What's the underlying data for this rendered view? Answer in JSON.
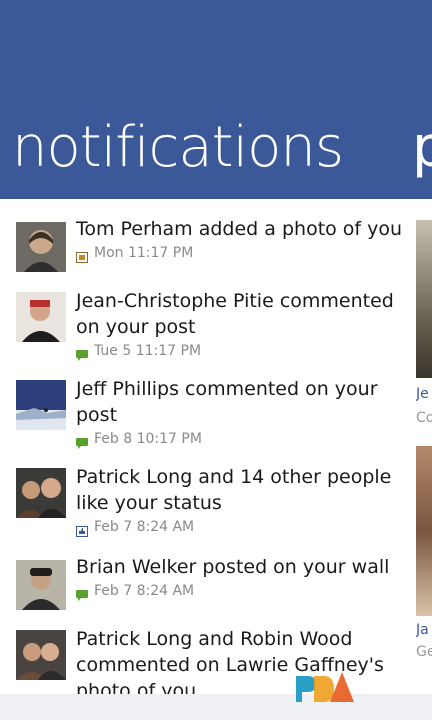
{
  "header": {
    "title": "notifications",
    "next_pivot_peek": "p",
    "color": "#3b5998"
  },
  "notifications": [
    {
      "message": "Tom Perham added a photo of you",
      "time": "Mon 11:17 PM",
      "icon": "photo-icon"
    },
    {
      "message": "Jean-Christophe Pitie commented on your post",
      "time": "Tue 5 11:17 PM",
      "icon": "comment-icon"
    },
    {
      "message": "Jeff Phillips commented on your post",
      "time": "Feb 8 10:17 PM",
      "icon": "comment-icon"
    },
    {
      "message": "Patrick Long and 14 other people like your status",
      "time": "Feb 7 8:24 AM",
      "icon": "like-icon"
    },
    {
      "message": "Brian Welker posted on your wall",
      "time": "Feb 7 8:24 AM",
      "icon": "comment-icon"
    },
    {
      "message": "Patrick Long and Robin Wood commented on Lawrie Gaffney's photo of you",
      "time": "",
      "icon": "comment-icon"
    }
  ],
  "side_panel": {
    "item1_title": "Je",
    "item1_sub": "Co",
    "item2_title": "Ja",
    "item2_sub": "Ge"
  }
}
